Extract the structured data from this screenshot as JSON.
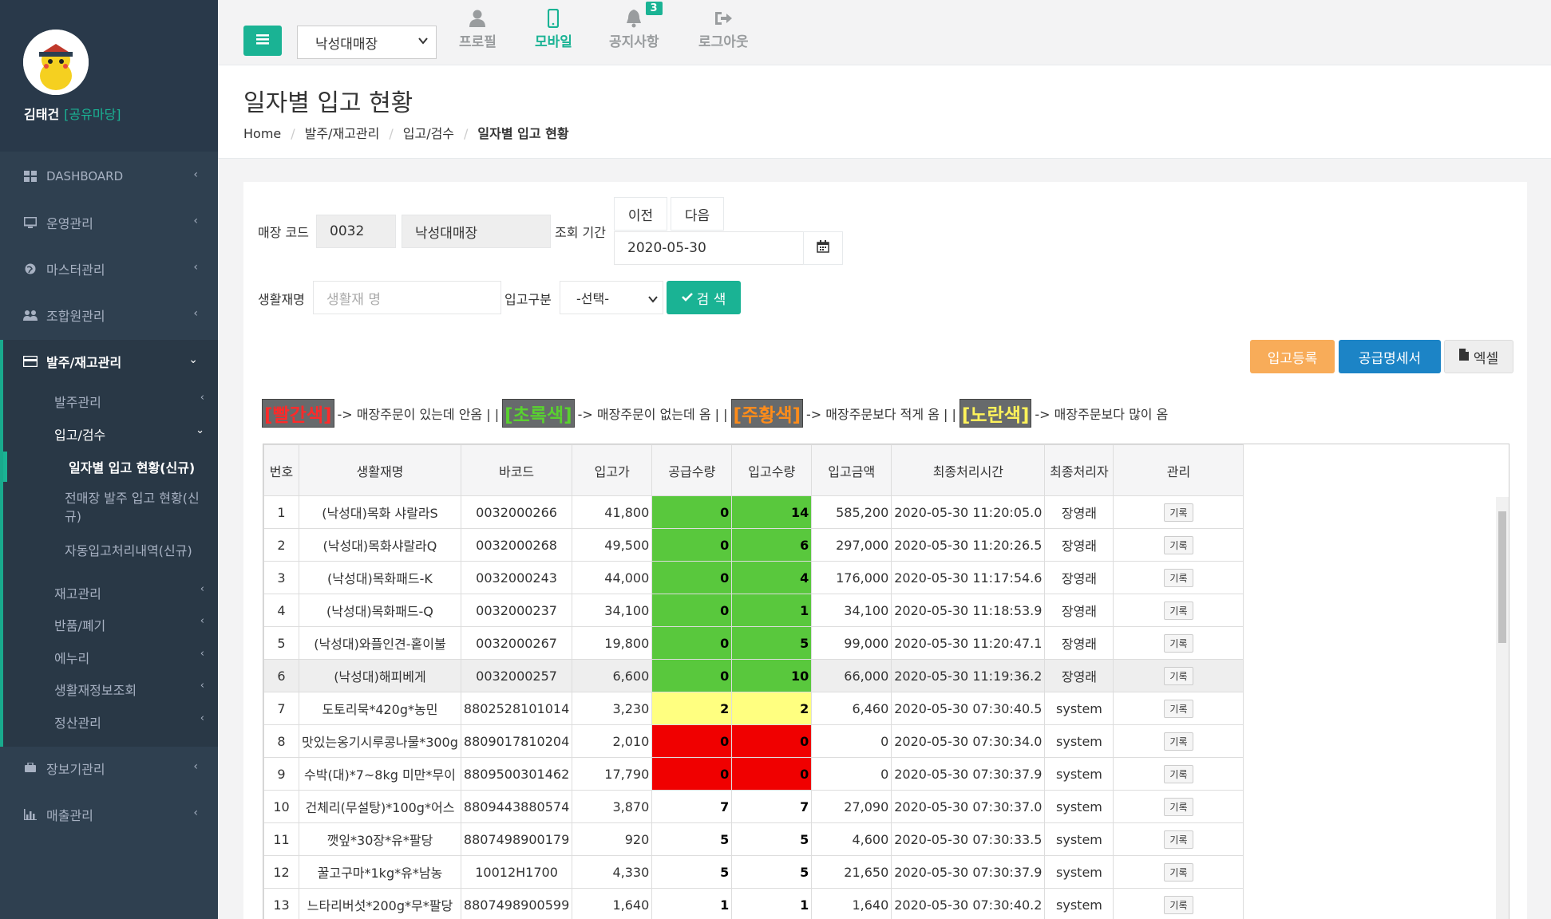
{
  "user": {
    "name": "김태건",
    "group": "[공유마당]"
  },
  "sidebar": {
    "items": [
      {
        "label": "DASHBOARD",
        "icon": "dashboard-icon"
      },
      {
        "label": "운영관리",
        "icon": "monitor-icon"
      },
      {
        "label": "마스터관리",
        "icon": "globe-icon"
      },
      {
        "label": "조합원관리",
        "icon": "users-icon"
      },
      {
        "label": "발주/재고관리",
        "icon": "credit-card-icon"
      },
      {
        "label": "장보기관리",
        "icon": "cart-icon"
      },
      {
        "label": "매출관리",
        "icon": "bar-chart-icon"
      }
    ],
    "sub": [
      "발주관리",
      "입고/검수",
      "재고관리",
      "반품/폐기",
      "에누리",
      "생활재정보조회",
      "정산관리"
    ],
    "subsub": [
      "일자별 입고 현황(신규)",
      "전매장 발주 입고 현황(신규)",
      "자동입고처리내역(신규)"
    ]
  },
  "topbar": {
    "store": "낙성대매장",
    "nav": [
      {
        "label": "프로필",
        "icon": "user-icon"
      },
      {
        "label": "모바일",
        "icon": "mobile-icon"
      },
      {
        "label": "공지사항",
        "icon": "bell-icon",
        "badge": "3"
      },
      {
        "label": "로그아웃",
        "icon": "sign-out-icon"
      }
    ]
  },
  "page": {
    "title": "일자별 입고 현황",
    "breadcrumb": [
      "Home",
      "발주/재고관리",
      "입고/검수",
      "일자별 입고 현황"
    ]
  },
  "form": {
    "store_code_label": "매장 코드",
    "store_code": "0032",
    "store_name": "낙성대매장",
    "period_label": "조회 기간",
    "prev": "이전",
    "next": "다음",
    "date": "2020-05-30",
    "item_label": "생활재명",
    "item_placeholder": "생활재 명",
    "type_label": "입고구분",
    "type_value": "-선택-",
    "search": "검 색"
  },
  "actions": {
    "register": "입고등록",
    "supply": "공급명세서",
    "excel": "엑셀"
  },
  "legend": {
    "red": "[빨간색]",
    "red_desc": "-> 매장주문이 있는데 안옴 | |",
    "green": "[초록색]",
    "green_desc": "-> 매장주문이 없는데 옴 | |",
    "orange": "[주황색]",
    "orange_desc": "-> 매장주문보다 적게 옴 | |",
    "yellow": "[노란색]",
    "yellow_desc": "-> 매장주문보다 많이 옴",
    "colors": {
      "red": "#ff2a2a",
      "green": "#59d12f",
      "orange": "#ff8c1a",
      "yellow": "#fff35a"
    }
  },
  "table": {
    "headers": [
      "번호",
      "생활재명",
      "바코드",
      "입고가",
      "공급수량",
      "입고수량",
      "입고금액",
      "최종처리시간",
      "최종처리자",
      "관리"
    ],
    "record_label": "기록",
    "rows": [
      [
        "1",
        "(낙성대)목화 샤랄라S",
        "0032000266",
        "41,800",
        "0",
        "14",
        "585,200",
        "2020-05-30 11:20:05.0",
        "장영래",
        "g"
      ],
      [
        "2",
        "(낙성대)목화샤랄라Q",
        "0032000268",
        "49,500",
        "0",
        "6",
        "297,000",
        "2020-05-30 11:20:26.5",
        "장영래",
        "g"
      ],
      [
        "3",
        "(낙성대)목화패드-K",
        "0032000243",
        "44,000",
        "0",
        "4",
        "176,000",
        "2020-05-30 11:17:54.6",
        "장영래",
        "g"
      ],
      [
        "4",
        "(낙성대)목화패드-Q",
        "0032000237",
        "34,100",
        "0",
        "1",
        "34,100",
        "2020-05-30 11:18:53.9",
        "장영래",
        "g"
      ],
      [
        "5",
        "(낙성대)와플인견-홑이불",
        "0032000267",
        "19,800",
        "0",
        "5",
        "99,000",
        "2020-05-30 11:20:47.1",
        "장영래",
        "g"
      ],
      [
        "6",
        "(낙성대)해피베게",
        "0032000257",
        "6,600",
        "0",
        "10",
        "66,000",
        "2020-05-30 11:19:36.2",
        "장영래",
        "g"
      ],
      [
        "7",
        "도토리묵*420g*농민",
        "8802528101014",
        "3,230",
        "2",
        "2",
        "6,460",
        "2020-05-30 07:30:40.5",
        "system",
        "y"
      ],
      [
        "8",
        "맛있는옹기시루콩나물*300g",
        "8809017810204",
        "2,010",
        "0",
        "0",
        "0",
        "2020-05-30 07:30:34.0",
        "system",
        "r"
      ],
      [
        "9",
        "수박(대)*7~8kg 미만*무이",
        "8809500301462",
        "17,790",
        "0",
        "0",
        "0",
        "2020-05-30 07:30:37.9",
        "system",
        "r"
      ],
      [
        "10",
        "건체리(무설탕)*100g*어스",
        "8809443880574",
        "3,870",
        "7",
        "7",
        "27,090",
        "2020-05-30 07:30:37.0",
        "system",
        ""
      ],
      [
        "11",
        "깻잎*30장*유*팔당",
        "8807498900179",
        "920",
        "5",
        "5",
        "4,600",
        "2020-05-30 07:30:33.5",
        "system",
        ""
      ],
      [
        "12",
        "꿀고구마*1kg*유*남농",
        "10012H1700",
        "4,330",
        "5",
        "5",
        "21,650",
        "2020-05-30 07:30:37.9",
        "system",
        ""
      ],
      [
        "13",
        "느타리버섯*200g*무*팔당",
        "8807498900599",
        "1,640",
        "1",
        "1",
        "1,640",
        "2020-05-30 07:30:40.2",
        "system",
        ""
      ]
    ]
  }
}
